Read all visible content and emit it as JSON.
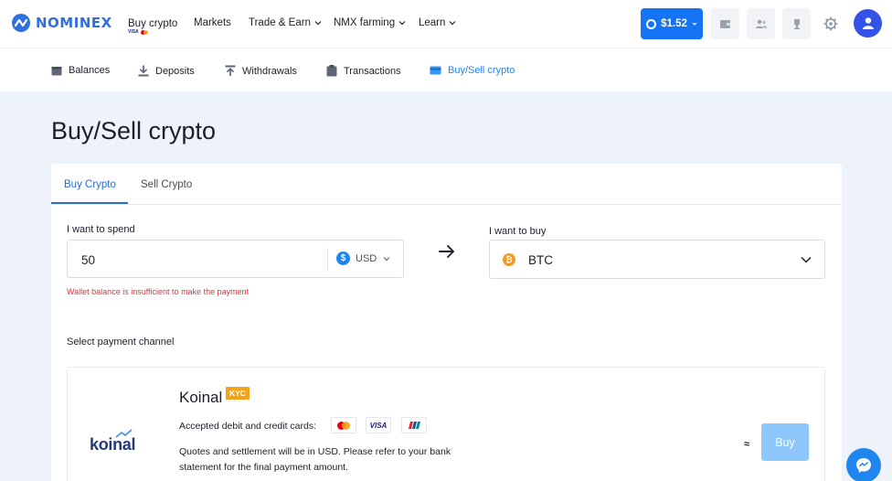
{
  "brand": {
    "name": "NOMINEX",
    "color": "#2f6fe0"
  },
  "topnav": {
    "items": [
      {
        "label": "Buy crypto",
        "sublabel": "VISA"
      },
      {
        "label": "Markets"
      },
      {
        "label": "Trade & Earn"
      },
      {
        "label": "NMX farming"
      },
      {
        "label": "Learn"
      }
    ],
    "balance": "$1.52"
  },
  "subnav": {
    "items": [
      {
        "label": "Balances"
      },
      {
        "label": "Deposits"
      },
      {
        "label": "Withdrawals"
      },
      {
        "label": "Transactions"
      },
      {
        "label": "Buy/Sell crypto",
        "active": true
      }
    ]
  },
  "page": {
    "title": "Buy/Sell crypto"
  },
  "tabs": [
    {
      "label": "Buy Crypto",
      "active": true
    },
    {
      "label": "Sell Crypto"
    }
  ],
  "spend": {
    "label": "I want to spend",
    "value": "50",
    "currency": "USD",
    "currency_icon": "$",
    "error": "Wallet balance is insufficient to make the payment"
  },
  "buy": {
    "label": "I want to buy",
    "value": "BTC",
    "icon": "₿"
  },
  "channel": {
    "label": "Select payment channel",
    "provider": {
      "logo_text": "koinal",
      "name": "Koinal",
      "badge": "KYC",
      "accepted_label": "Accepted debit and credit cards:",
      "cards": [
        "mastercard",
        "VISA",
        "unionpay"
      ],
      "quote_text": "Quotes and settlement will be in USD. Please refer to your bank statement for the final payment amount.",
      "approx": "≈",
      "buy_label": "Buy"
    }
  },
  "colors": {
    "accent": "#1f86f0",
    "error": "#d9363e",
    "kyc": "#f5a316",
    "btc": "#f29a26"
  }
}
